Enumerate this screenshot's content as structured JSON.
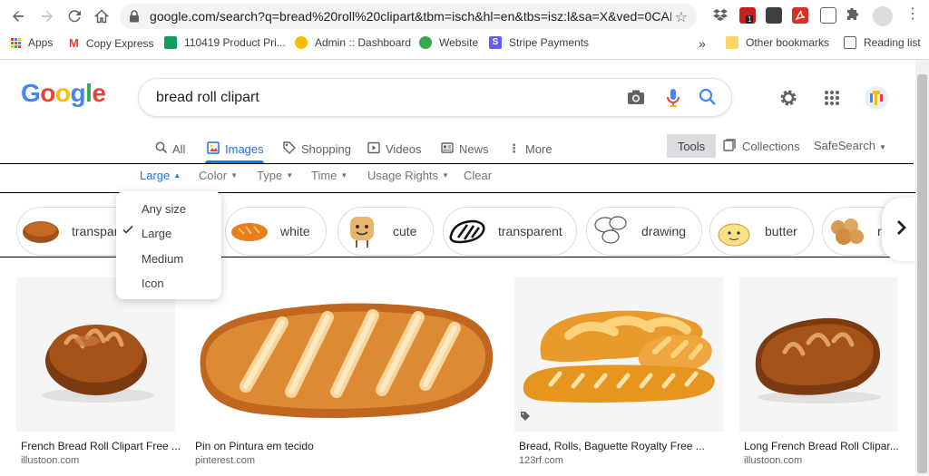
{
  "browser": {
    "url": "google.com/search?q=bread%20roll%20clipart&tbm=isch&hl=en&tbs=isz:l&sa=X&ved=0CAI...",
    "ext_badge": "1",
    "bookmarks": [
      {
        "label": "Apps",
        "color": "#4285f4"
      },
      {
        "label": "Copy Express",
        "color": "#ea4335"
      },
      {
        "label": "110419 Product Pri...",
        "color": "#0f9d58"
      },
      {
        "label": "Admin :: Dashboard",
        "color": "#fbbc04"
      },
      {
        "label": "Website",
        "color": "#34a853"
      },
      {
        "label": "Stripe Payments",
        "color": "#635bff"
      }
    ],
    "more_bookmarks": "»",
    "other_bookmarks": "Other bookmarks",
    "reading_list": "Reading list"
  },
  "google": {
    "logo": [
      "G",
      "o",
      "o",
      "g",
      "l",
      "e"
    ],
    "logo_colors": [
      "#4285f4",
      "#ea4335",
      "#fbbc05",
      "#4285f4",
      "#34a853",
      "#ea4335"
    ],
    "query": "bread roll clipart"
  },
  "tabs": [
    {
      "label": "All",
      "icon": "search-icon",
      "active": false
    },
    {
      "label": "Images",
      "icon": "image-icon",
      "active": true
    },
    {
      "label": "Shopping",
      "icon": "tag-icon",
      "active": false
    },
    {
      "label": "Videos",
      "icon": "video-icon",
      "active": false
    },
    {
      "label": "News",
      "icon": "news-icon",
      "active": false
    },
    {
      "label": "More",
      "icon": "more-icon",
      "active": false
    }
  ],
  "tools": {
    "tools_label": "Tools",
    "collections_label": "Collections",
    "safesearch_label": "SafeSearch"
  },
  "filters": {
    "size": "Large",
    "color": "Color",
    "type": "Type",
    "time": "Time",
    "rights": "Usage Rights",
    "clear": "Clear"
  },
  "size_menu": {
    "items": [
      "Any size",
      "Large",
      "Medium",
      "Icon"
    ],
    "selected": "Large"
  },
  "chips": [
    {
      "label": "transparent"
    },
    {
      "label": "white"
    },
    {
      "label": "cute"
    },
    {
      "label": "transparent"
    },
    {
      "label": "drawing"
    },
    {
      "label": "butter"
    },
    {
      "label": "r"
    }
  ],
  "results": [
    {
      "title": "French Bread Roll Clipart Free ...",
      "source": "illustoon.com"
    },
    {
      "title": "Pin on Pintura em tecido",
      "source": "pinterest.com"
    },
    {
      "title": "Bread, Rolls, Baguette Royalty Free ...",
      "source": "123rf.com"
    },
    {
      "title": "Long French Bread Roll Clipar...",
      "source": "illustoon.com"
    }
  ]
}
